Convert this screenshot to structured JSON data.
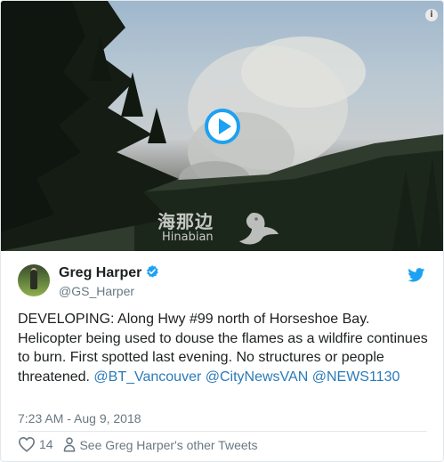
{
  "media": {
    "watermark_cn": "海那边",
    "watermark_en": "Hinabian"
  },
  "tweet": {
    "author_name": "Greg Harper",
    "author_handle": "@GS_Harper",
    "text": "DEVELOPING: Along Hwy #99 north of Horseshoe Bay. Helicopter being used to douse the flames as a wildfire continues to burn. First spotted last evening. No structures or people threatened.",
    "mentions": [
      "@BT_Vancouver",
      "@CityNewsVAN",
      "@NEWS1130"
    ],
    "timestamp": "7:23 AM - Aug 9, 2018",
    "like_count": "14",
    "see_others_label": "See Greg Harper's other Tweets"
  },
  "colors": {
    "accent": "#1da1f2",
    "link": "#2b7bb9",
    "muted": "#697882"
  },
  "icons": {
    "info": "info-icon",
    "play": "play-icon",
    "verified": "verified-badge-icon",
    "brand": "twitter-bird-icon",
    "like": "heart-icon",
    "person": "person-icon"
  }
}
